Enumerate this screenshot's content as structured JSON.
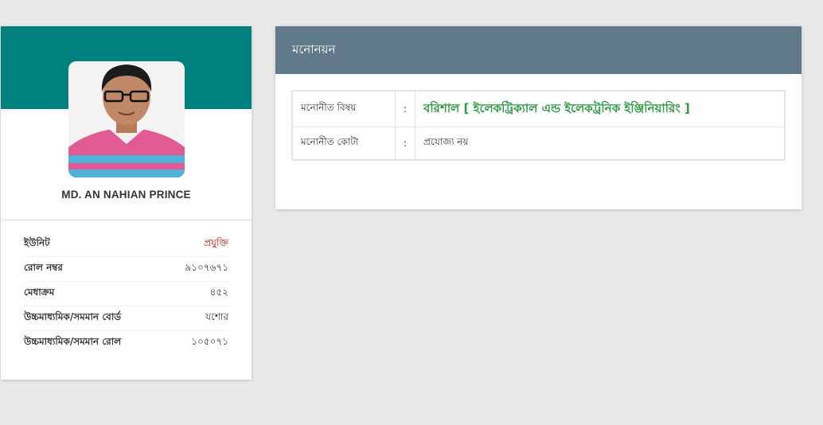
{
  "colors": {
    "banner": "#00807f",
    "nomination_header": "#617a89",
    "accent_red": "#cc0000",
    "subject_green": "#2e9a44"
  },
  "profile": {
    "photo_icon": "student-photo",
    "name": "MD. AN NAHIAN PRINCE",
    "info": [
      {
        "label": "ইউনিট",
        "value": "প্রযুক্তি",
        "accent": true
      },
      {
        "label": "রোল নম্বর",
        "value": "৯১০৭৬৭১",
        "accent": false
      },
      {
        "label": "মেধাক্রম",
        "value": "৪৫২",
        "accent": false
      },
      {
        "label": "উচ্চমাধ্যমিক/সমমান বোর্ড",
        "value": "যশোর",
        "accent": false
      },
      {
        "label": "উচ্চমাধ্যমিক/সমমান রোল",
        "value": "১০৫০৭১",
        "accent": false
      }
    ]
  },
  "nomination": {
    "title": "মনোনয়ন",
    "rows": [
      {
        "label": "মনোনীত বিষয়",
        "colon": ":",
        "value": "বরিশাল [ ইলেকট্রিক্যাল এন্ড ইলেকট্রনিক ইঞ্জিনিয়ারিং ]"
      },
      {
        "label": "মনোনীত কোটা",
        "colon": ":",
        "value": "প্রযোজ্য নয়"
      }
    ]
  }
}
